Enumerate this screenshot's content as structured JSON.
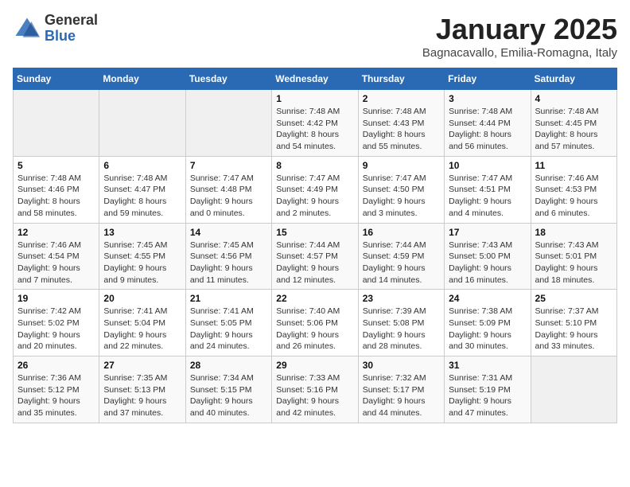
{
  "header": {
    "logo_general": "General",
    "logo_blue": "Blue",
    "month_title": "January 2025",
    "location": "Bagnacavallo, Emilia-Romagna, Italy"
  },
  "weekdays": [
    "Sunday",
    "Monday",
    "Tuesday",
    "Wednesday",
    "Thursday",
    "Friday",
    "Saturday"
  ],
  "weeks": [
    [
      {
        "day": "",
        "sunrise": "",
        "sunset": "",
        "daylight": ""
      },
      {
        "day": "",
        "sunrise": "",
        "sunset": "",
        "daylight": ""
      },
      {
        "day": "",
        "sunrise": "",
        "sunset": "",
        "daylight": ""
      },
      {
        "day": "1",
        "sunrise": "Sunrise: 7:48 AM",
        "sunset": "Sunset: 4:42 PM",
        "daylight": "Daylight: 8 hours and 54 minutes."
      },
      {
        "day": "2",
        "sunrise": "Sunrise: 7:48 AM",
        "sunset": "Sunset: 4:43 PM",
        "daylight": "Daylight: 8 hours and 55 minutes."
      },
      {
        "day": "3",
        "sunrise": "Sunrise: 7:48 AM",
        "sunset": "Sunset: 4:44 PM",
        "daylight": "Daylight: 8 hours and 56 minutes."
      },
      {
        "day": "4",
        "sunrise": "Sunrise: 7:48 AM",
        "sunset": "Sunset: 4:45 PM",
        "daylight": "Daylight: 8 hours and 57 minutes."
      }
    ],
    [
      {
        "day": "5",
        "sunrise": "Sunrise: 7:48 AM",
        "sunset": "Sunset: 4:46 PM",
        "daylight": "Daylight: 8 hours and 58 minutes."
      },
      {
        "day": "6",
        "sunrise": "Sunrise: 7:48 AM",
        "sunset": "Sunset: 4:47 PM",
        "daylight": "Daylight: 8 hours and 59 minutes."
      },
      {
        "day": "7",
        "sunrise": "Sunrise: 7:47 AM",
        "sunset": "Sunset: 4:48 PM",
        "daylight": "Daylight: 9 hours and 0 minutes."
      },
      {
        "day": "8",
        "sunrise": "Sunrise: 7:47 AM",
        "sunset": "Sunset: 4:49 PM",
        "daylight": "Daylight: 9 hours and 2 minutes."
      },
      {
        "day": "9",
        "sunrise": "Sunrise: 7:47 AM",
        "sunset": "Sunset: 4:50 PM",
        "daylight": "Daylight: 9 hours and 3 minutes."
      },
      {
        "day": "10",
        "sunrise": "Sunrise: 7:47 AM",
        "sunset": "Sunset: 4:51 PM",
        "daylight": "Daylight: 9 hours and 4 minutes."
      },
      {
        "day": "11",
        "sunrise": "Sunrise: 7:46 AM",
        "sunset": "Sunset: 4:53 PM",
        "daylight": "Daylight: 9 hours and 6 minutes."
      }
    ],
    [
      {
        "day": "12",
        "sunrise": "Sunrise: 7:46 AM",
        "sunset": "Sunset: 4:54 PM",
        "daylight": "Daylight: 9 hours and 7 minutes."
      },
      {
        "day": "13",
        "sunrise": "Sunrise: 7:45 AM",
        "sunset": "Sunset: 4:55 PM",
        "daylight": "Daylight: 9 hours and 9 minutes."
      },
      {
        "day": "14",
        "sunrise": "Sunrise: 7:45 AM",
        "sunset": "Sunset: 4:56 PM",
        "daylight": "Daylight: 9 hours and 11 minutes."
      },
      {
        "day": "15",
        "sunrise": "Sunrise: 7:44 AM",
        "sunset": "Sunset: 4:57 PM",
        "daylight": "Daylight: 9 hours and 12 minutes."
      },
      {
        "day": "16",
        "sunrise": "Sunrise: 7:44 AM",
        "sunset": "Sunset: 4:59 PM",
        "daylight": "Daylight: 9 hours and 14 minutes."
      },
      {
        "day": "17",
        "sunrise": "Sunrise: 7:43 AM",
        "sunset": "Sunset: 5:00 PM",
        "daylight": "Daylight: 9 hours and 16 minutes."
      },
      {
        "day": "18",
        "sunrise": "Sunrise: 7:43 AM",
        "sunset": "Sunset: 5:01 PM",
        "daylight": "Daylight: 9 hours and 18 minutes."
      }
    ],
    [
      {
        "day": "19",
        "sunrise": "Sunrise: 7:42 AM",
        "sunset": "Sunset: 5:02 PM",
        "daylight": "Daylight: 9 hours and 20 minutes."
      },
      {
        "day": "20",
        "sunrise": "Sunrise: 7:41 AM",
        "sunset": "Sunset: 5:04 PM",
        "daylight": "Daylight: 9 hours and 22 minutes."
      },
      {
        "day": "21",
        "sunrise": "Sunrise: 7:41 AM",
        "sunset": "Sunset: 5:05 PM",
        "daylight": "Daylight: 9 hours and 24 minutes."
      },
      {
        "day": "22",
        "sunrise": "Sunrise: 7:40 AM",
        "sunset": "Sunset: 5:06 PM",
        "daylight": "Daylight: 9 hours and 26 minutes."
      },
      {
        "day": "23",
        "sunrise": "Sunrise: 7:39 AM",
        "sunset": "Sunset: 5:08 PM",
        "daylight": "Daylight: 9 hours and 28 minutes."
      },
      {
        "day": "24",
        "sunrise": "Sunrise: 7:38 AM",
        "sunset": "Sunset: 5:09 PM",
        "daylight": "Daylight: 9 hours and 30 minutes."
      },
      {
        "day": "25",
        "sunrise": "Sunrise: 7:37 AM",
        "sunset": "Sunset: 5:10 PM",
        "daylight": "Daylight: 9 hours and 33 minutes."
      }
    ],
    [
      {
        "day": "26",
        "sunrise": "Sunrise: 7:36 AM",
        "sunset": "Sunset: 5:12 PM",
        "daylight": "Daylight: 9 hours and 35 minutes."
      },
      {
        "day": "27",
        "sunrise": "Sunrise: 7:35 AM",
        "sunset": "Sunset: 5:13 PM",
        "daylight": "Daylight: 9 hours and 37 minutes."
      },
      {
        "day": "28",
        "sunrise": "Sunrise: 7:34 AM",
        "sunset": "Sunset: 5:15 PM",
        "daylight": "Daylight: 9 hours and 40 minutes."
      },
      {
        "day": "29",
        "sunrise": "Sunrise: 7:33 AM",
        "sunset": "Sunset: 5:16 PM",
        "daylight": "Daylight: 9 hours and 42 minutes."
      },
      {
        "day": "30",
        "sunrise": "Sunrise: 7:32 AM",
        "sunset": "Sunset: 5:17 PM",
        "daylight": "Daylight: 9 hours and 44 minutes."
      },
      {
        "day": "31",
        "sunrise": "Sunrise: 7:31 AM",
        "sunset": "Sunset: 5:19 PM",
        "daylight": "Daylight: 9 hours and 47 minutes."
      },
      {
        "day": "",
        "sunrise": "",
        "sunset": "",
        "daylight": ""
      }
    ]
  ]
}
